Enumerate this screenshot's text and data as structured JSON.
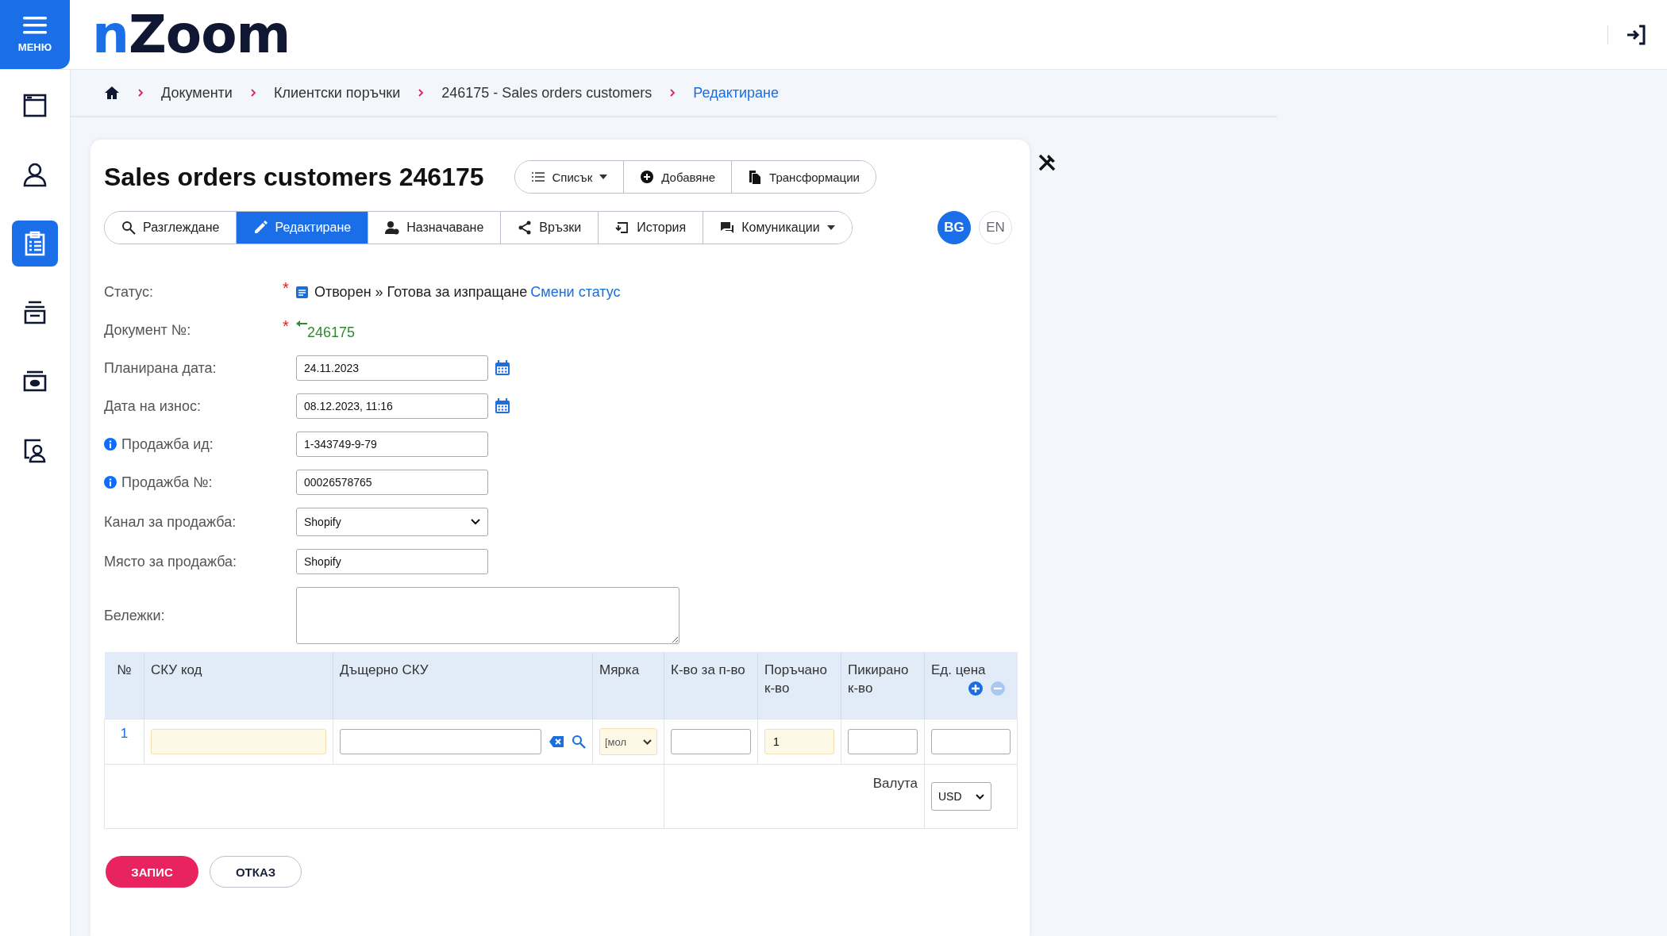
{
  "menu_button": {
    "label": "МЕНЮ"
  },
  "logo": {
    "accent": "n",
    "text": "Zoom"
  },
  "sidebar": {
    "items": [
      {
        "kind": "window",
        "selected": false
      },
      {
        "kind": "person",
        "selected": false
      },
      {
        "kind": "clipboard",
        "selected": true
      },
      {
        "kind": "tray",
        "selected": false
      },
      {
        "kind": "cash",
        "selected": false
      },
      {
        "kind": "contact",
        "selected": false
      }
    ]
  },
  "breadcrumbs": [
    {
      "label": "Документи",
      "selected": false
    },
    {
      "label": "Клиентски поръчки",
      "selected": false
    },
    {
      "label": "246175 - Sales orders customers",
      "selected": false
    },
    {
      "label": "Редактиране",
      "selected": true
    }
  ],
  "title": "Sales orders customers 246175",
  "toolbar": [
    {
      "kind": "list",
      "label": "Списък",
      "dropdown": true
    },
    {
      "kind": "add",
      "label": "Добавяне",
      "dropdown": false
    },
    {
      "kind": "copy",
      "label": "Трансформации",
      "dropdown": false
    }
  ],
  "tabs": [
    {
      "kind": "search",
      "label": "Разглеждане",
      "selected": false,
      "dropdown": false
    },
    {
      "kind": "pencil",
      "label": "Редактиране",
      "selected": true,
      "dropdown": false
    },
    {
      "kind": "assign",
      "label": "Назначаване",
      "selected": false,
      "dropdown": false
    },
    {
      "kind": "share",
      "label": "Връзки",
      "selected": false,
      "dropdown": false
    },
    {
      "kind": "history",
      "label": "История",
      "selected": false,
      "dropdown": false
    },
    {
      "kind": "chat",
      "label": "Комуникации",
      "selected": false,
      "dropdown": true
    }
  ],
  "languages": [
    {
      "label": "BG",
      "selected": true
    },
    {
      "label": "EN",
      "selected": false
    }
  ],
  "form": [
    {
      "kind": "status",
      "label": "Статус:",
      "required": true,
      "info": false,
      "value": "Отворен » Готова за изпращане",
      "link": "Смени статус"
    },
    {
      "kind": "doc",
      "label": "Документ №:",
      "required": true,
      "info": false,
      "value": "246175"
    },
    {
      "kind": "date",
      "label": "Планирана дата:",
      "required": false,
      "info": false,
      "value": "24.11.2023"
    },
    {
      "kind": "date",
      "label": "Дата на износ:",
      "required": false,
      "info": false,
      "value": "08.12.2023, 11:16"
    },
    {
      "kind": "text",
      "label": "Продажба ид:",
      "required": false,
      "info": true,
      "value": "1-343749-9-79"
    },
    {
      "kind": "text",
      "label": "Продажба №:",
      "required": false,
      "info": true,
      "value": "00026578765"
    },
    {
      "kind": "select",
      "label": "Канал за продажба:",
      "required": false,
      "info": false,
      "value": "Shopify"
    },
    {
      "kind": "text",
      "label": "Място за продажба:",
      "required": false,
      "info": false,
      "value": "Shopify"
    },
    {
      "kind": "textarea",
      "label": "Бележки:",
      "required": false,
      "info": false
    }
  ],
  "required_mark": "*",
  "table": {
    "columns": [
      "№",
      "СКУ код",
      "Дъщерно СКУ",
      "Мярка",
      "К-во за п-во",
      "Поръчано к-во",
      "Пикирано к-во",
      "Ед. цена"
    ],
    "rows": [
      {
        "cells": [
          {
            "kind": "number",
            "value": "1"
          },
          {
            "kind": "input",
            "highlighted": true
          },
          {
            "kind": "search",
            "highlighted": false
          },
          {
            "kind": "select",
            "value": "[мол",
            "highlighted": true
          },
          {
            "kind": "input",
            "highlighted": false
          },
          {
            "kind": "input",
            "value": "1",
            "highlighted": true
          },
          {
            "kind": "input",
            "highlighted": false
          },
          {
            "kind": "input",
            "highlighted": false
          }
        ]
      }
    ],
    "currency_label": "Валута",
    "currency": "USD"
  },
  "buttons": [
    {
      "kind": "primary",
      "label": "ЗАПИС"
    },
    {
      "kind": "secondary",
      "label": "ОТКАЗ"
    }
  ]
}
